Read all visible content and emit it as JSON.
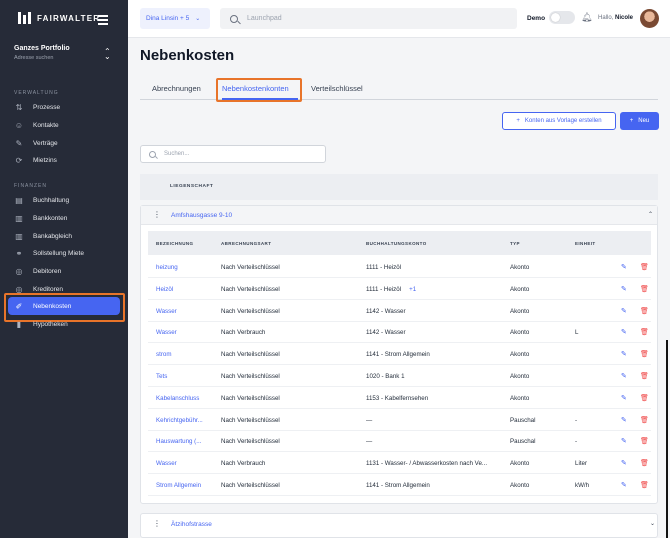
{
  "brand": {
    "name": "FAIRWALTER"
  },
  "portfolio": {
    "title": "Ganzes Portfolio",
    "subtitle": "Adresse suchen"
  },
  "sidebar": {
    "sections": [
      {
        "label": "VERWALTUNG"
      },
      {
        "label": "FINANZEN"
      }
    ],
    "items": [
      {
        "label": "Prozesse",
        "icon": "process-icon"
      },
      {
        "label": "Kontakte",
        "icon": "contacts-icon"
      },
      {
        "label": "Verträge",
        "icon": "contract-icon"
      },
      {
        "label": "Mietzins",
        "icon": "rent-icon"
      },
      {
        "label": "Buchhaltung",
        "icon": "accounting-icon"
      },
      {
        "label": "Bankkonten",
        "icon": "bank-icon"
      },
      {
        "label": "Bankabgleich",
        "icon": "bank-reconcile-icon"
      },
      {
        "label": "Sollstellung Miete",
        "icon": "target-rent-icon"
      },
      {
        "label": "Debitoren",
        "icon": "debtors-icon"
      },
      {
        "label": "Kreditoren",
        "icon": "creditors-icon"
      },
      {
        "label": "Nebenkosten",
        "icon": "utilities-icon",
        "active": true
      },
      {
        "label": "Hypotheken",
        "icon": "mortgage-icon"
      }
    ]
  },
  "topbar": {
    "user_select": "Dina Linsin + 5",
    "search_placeholder": "Launchpad",
    "demo_label": "Demo",
    "hello": "Hallo,",
    "user_name": "Nicole"
  },
  "page": {
    "title": "Nebenkosten",
    "tabs": [
      {
        "label": "Abrechnungen",
        "active": false
      },
      {
        "label": "Nebenkostenkonten",
        "active": true
      },
      {
        "label": "Verteilschlüssel",
        "active": false
      }
    ],
    "btn_template": "Konten aus Vorlage erstellen",
    "btn_new": "Neu",
    "search_placeholder": "Suchen...",
    "property_header": "LIEGENSCHAFT"
  },
  "properties": [
    {
      "name": "Amfshausgasse 9-10",
      "expanded": true,
      "columns": [
        "BEZEICHNUNG",
        "ABRECHNUNGSART",
        "BUCHHALTUNGSKONTO",
        "TYP",
        "EINHEIT"
      ],
      "rows": [
        {
          "name": "heizung",
          "method": "Nach Verteilschlüssel",
          "account": "1111 - Heizöl",
          "extra": "",
          "type": "Akonto",
          "unit": ""
        },
        {
          "name": "Heizöl",
          "method": "Nach Verteilschlüssel",
          "account": "1111 - Heizöl",
          "extra": "+1",
          "type": "Akonto",
          "unit": ""
        },
        {
          "name": "Wasser",
          "method": "Nach Verteilschlüssel",
          "account": "1142 - Wasser",
          "extra": "",
          "type": "Akonto",
          "unit": ""
        },
        {
          "name": "Wasser",
          "method": "Nach Verbrauch",
          "account": "1142 - Wasser",
          "extra": "",
          "type": "Akonto",
          "unit": "L"
        },
        {
          "name": "strom",
          "method": "Nach Verteilschlüssel",
          "account": "1141 - Strom Allgemein",
          "extra": "",
          "type": "Akonto",
          "unit": ""
        },
        {
          "name": "Tets",
          "method": "Nach Verteilschlüssel",
          "account": "1020 - Bank 1",
          "extra": "",
          "type": "Akonto",
          "unit": ""
        },
        {
          "name": "Kabelanschluss",
          "method": "Nach Verteilschlüssel",
          "account": "1153 - Kabelfernsehen",
          "extra": "",
          "type": "Akonto",
          "unit": ""
        },
        {
          "name": "Kehrichtgebühr...",
          "method": "Nach Verteilschlüssel",
          "account": "—",
          "extra": "",
          "type": "Pauschal",
          "unit": "-"
        },
        {
          "name": "Hauswartung (...",
          "method": "Nach Verteilschlüssel",
          "account": "—",
          "extra": "",
          "type": "Pauschal",
          "unit": "-"
        },
        {
          "name": "Wasser",
          "method": "Nach Verbrauch",
          "account": "1131 - Wasser- / Abwasserkosten nach Ve...",
          "extra": "",
          "type": "Akonto",
          "unit": "Liter"
        },
        {
          "name": "Strom Allgemein",
          "method": "Nach Verteilschlüssel",
          "account": "1141 - Strom Allgemein",
          "extra": "",
          "type": "Akonto",
          "unit": "kW/h"
        }
      ]
    },
    {
      "name": "Ätzihofstrasse",
      "expanded": false
    }
  ],
  "colors": {
    "accent": "#4665f1",
    "sidebar": "#262b38",
    "highlight": "#e8742a",
    "danger": "#ef4444"
  }
}
